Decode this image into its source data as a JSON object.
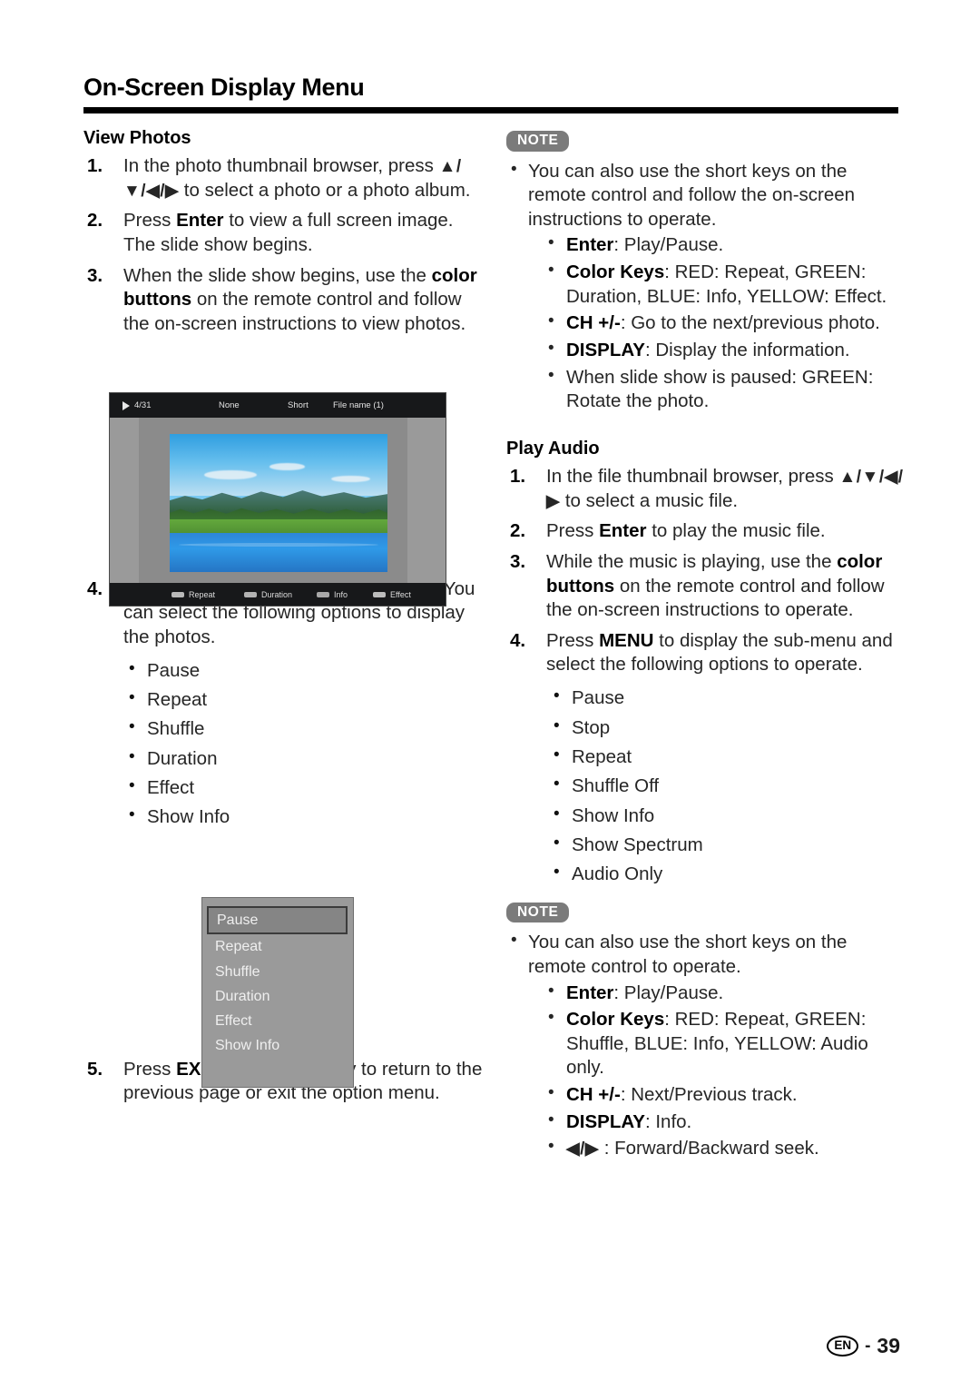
{
  "document": {
    "title": "On-Screen Display Menu",
    "footer": {
      "language_badge": "EN",
      "separator": "-",
      "page_number": "39"
    }
  },
  "left_column": {
    "section_heading": "View Photos",
    "steps": [
      {
        "number": "1.",
        "html": "In the photo thumbnail browser, press <span class=\"arrows\">&#9650;/&#9660;/&#9664;/&#9654;</span> to select a photo or a photo album."
      },
      {
        "number": "2.",
        "html": "Press <b>Enter</b> to view a full screen image. The slide show begins."
      },
      {
        "number": "3.",
        "html": "When the slide show begins, use the <b>color buttons</b> on the remote control and follow the on-screen instructions to view photos."
      },
      {
        "number": "4.",
        "html": "Press <b>MENU</b> to display the sub-menu. You can select the following options to display the photos."
      },
      {
        "number": "5.",
        "html": "Press <b>EXIT</b> or <b>RETURN</b> key to return to the previous page or exit the option menu."
      }
    ],
    "photo_options": [
      "Pause",
      "Repeat",
      "Shuffle",
      "Duration",
      "Effect",
      "Show Info"
    ]
  },
  "right_column": {
    "note_label_1": "NOTE",
    "note_1": {
      "intro": "You can also use the short keys on the remote control and follow the on-screen instructions to operate.",
      "items": [
        {
          "html": "<b>Enter</b>: Play/Pause."
        },
        {
          "html": "<b>Color Keys</b>: RED: Repeat, GREEN: Duration, BLUE: Info, YELLOW: Effect."
        },
        {
          "html": "<b>CH +/-</b>: Go to the next/previous photo."
        },
        {
          "html": "<b>DISPLAY</b>: Display the information."
        },
        {
          "html": "When slide show is paused: GREEN: Rotate the photo."
        }
      ]
    },
    "section_heading": "Play Audio",
    "steps": [
      {
        "number": "1.",
        "html": "In the file thumbnail browser, press <span class=\"arrows\">&#9650;/&#9660;/&#9664;/&#9654;</span> to select a music file."
      },
      {
        "number": "2.",
        "html": "Press <b>Enter</b> to play the music file."
      },
      {
        "number": "3.",
        "html": "While the music is playing, use the <b>color buttons</b> on the remote control and follow the on-screen instructions to operate."
      },
      {
        "number": "4.",
        "html": "Press <b>MENU</b> to display the sub-menu and select the following options to operate."
      }
    ],
    "audio_options": [
      "Pause",
      "Stop",
      "Repeat",
      "Shuffle Off",
      "Show Info",
      "Show Spectrum",
      "Audio Only"
    ],
    "note_label_2": "NOTE",
    "note_2": {
      "intro": "You can also use the short keys on the remote control to operate.",
      "items": [
        {
          "html": "<b>Enter</b>: Play/Pause."
        },
        {
          "html": "<b>Color Keys</b>: RED: Repeat, GREEN: Shuffle, BLUE: Info, YELLOW: Audio only."
        },
        {
          "html": "<b>CH +/-</b>: Next/Previous track."
        },
        {
          "html": "<b>DISPLAY</b>: Info."
        },
        {
          "html": "<span class=\"arrows\">&#9664;/&#9654;</span> : Forward/Backward seek."
        }
      ]
    }
  },
  "figures": {
    "tv_screenshot": {
      "topbar": {
        "play_icon": "play-icon",
        "counter": "4/31",
        "effect": "None",
        "duration": "Short",
        "filename": "File name (1)"
      },
      "color_keys": [
        {
          "label": "Repeat",
          "color": "#b9b9b9"
        },
        {
          "label": "Duration",
          "color": "#b3b3b3"
        },
        {
          "label": "Info",
          "color": "#a8a8a8"
        },
        {
          "label": "Effect",
          "color": "#bcbcbc"
        }
      ]
    },
    "osd_submenu": {
      "items": [
        {
          "label": "Pause",
          "selected": true
        },
        {
          "label": "Repeat",
          "selected": false
        },
        {
          "label": "Shuffle",
          "selected": false
        },
        {
          "label": "Duration",
          "selected": false
        },
        {
          "label": "Effect",
          "selected": false
        },
        {
          "label": "Show Info",
          "selected": false
        }
      ]
    }
  }
}
